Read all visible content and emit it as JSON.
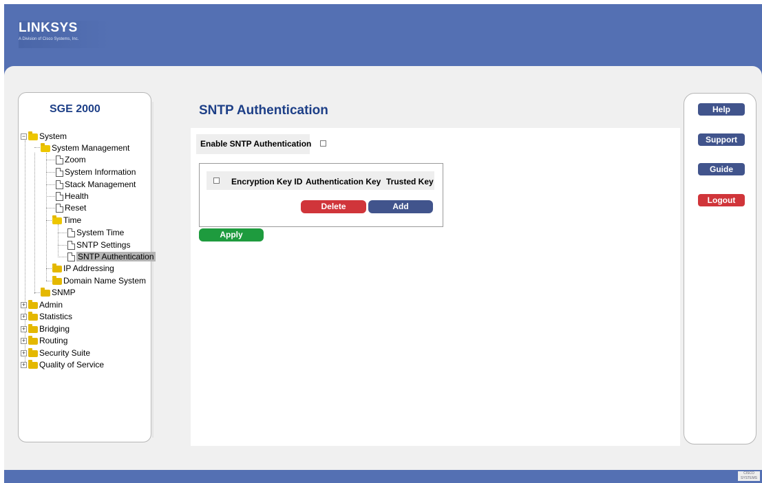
{
  "header": {
    "brand": "LINKSYS",
    "tagline": "A Division of Cisco Systems, Inc.",
    "cisco_mark": "CISCO SYSTEMS"
  },
  "nav": {
    "model": "SGE 2000",
    "tree": {
      "system": "System",
      "system_management": "System Management",
      "zoom": "Zoom",
      "system_information": "System Information",
      "stack_management": "Stack Management",
      "health": "Health",
      "reset": "Reset",
      "time": "Time",
      "system_time": "System Time",
      "sntp_settings": "SNTP Settings",
      "sntp_authentication": "SNTP Authentication",
      "ip_addressing": "IP Addressing",
      "domain_name_system": "Domain Name System",
      "snmp": "SNMP",
      "admin": "Admin",
      "statistics": "Statistics",
      "bridging": "Bridging",
      "routing": "Routing",
      "security_suite": "Security Suite",
      "quality_of_service": "Quality of Service"
    }
  },
  "main": {
    "title": "SNTP Authentication",
    "enable_label": "Enable SNTP Authentication",
    "enable_checked": false,
    "table": {
      "columns": [
        "Encryption Key ID",
        "Authentication Key",
        "Trusted Key"
      ],
      "rows": []
    },
    "delete_label": "Delete",
    "add_label": "Add",
    "apply_label": "Apply"
  },
  "side": {
    "help": "Help",
    "support": "Support",
    "guide": "Guide",
    "logout": "Logout"
  },
  "colors": {
    "header_blue": "#5470b3",
    "title_blue": "#1d3f87",
    "button_blue": "#41548c",
    "button_red": "#d0353a",
    "button_green": "#1e9b3e"
  }
}
